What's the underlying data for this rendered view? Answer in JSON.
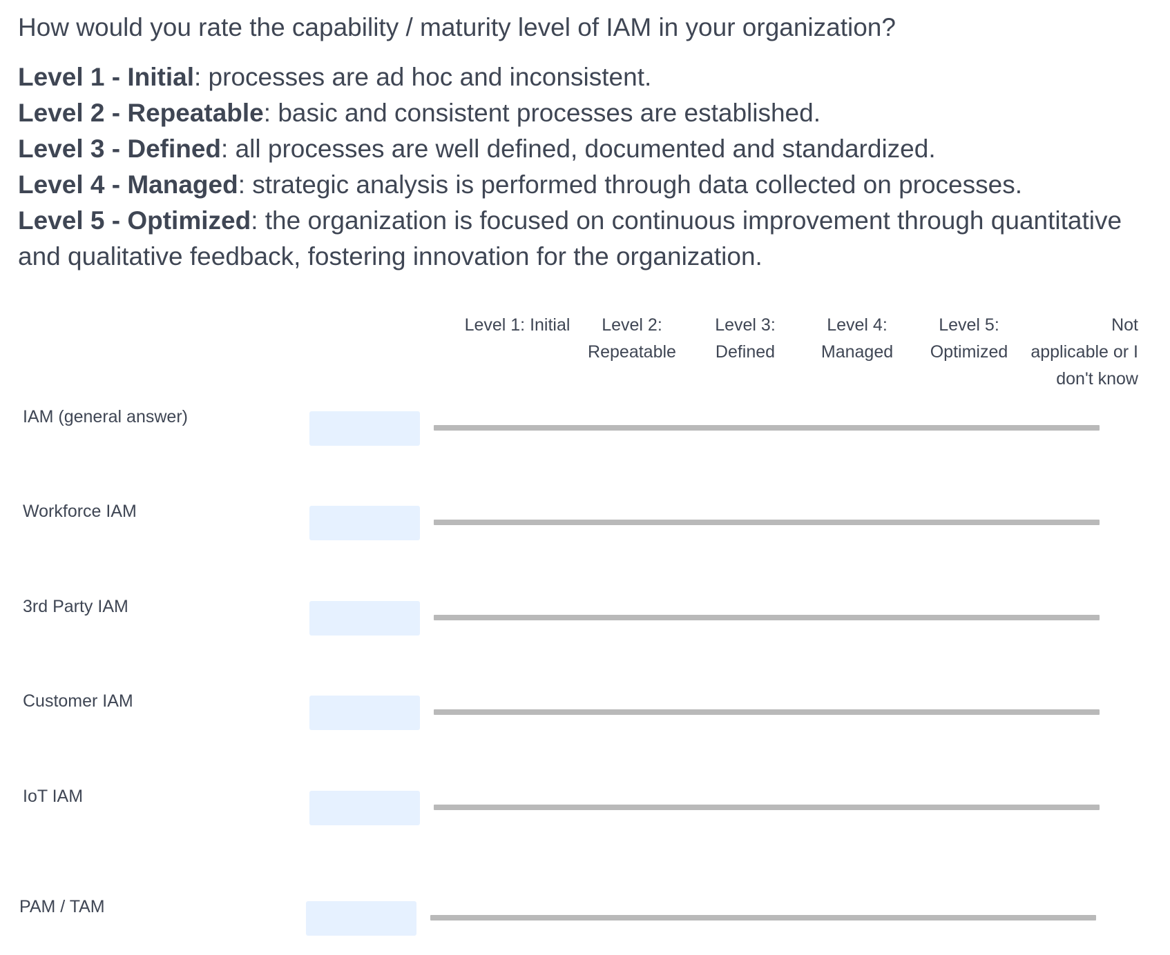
{
  "question": {
    "title": "How would you rate the capability / maturity level of IAM in your organization?",
    "levels": [
      {
        "name": "Level 1 - Initial",
        "desc": ": processes are ad hoc and inconsistent."
      },
      {
        "name": "Level 2 - Repeatable",
        "desc": ": basic and consistent processes are established."
      },
      {
        "name": "Level 3 - Defined",
        "desc": ": all processes are well defined, documented and standardized."
      },
      {
        "name": "Level 4 - Managed",
        "desc": ": strategic analysis is performed through data collected on processes."
      },
      {
        "name": "Level 5 - Optimized",
        "desc": ": the organization is focused on continuous improvement through quantitative and qualitative feedback, fostering innovation for the organization."
      }
    ]
  },
  "columns": [
    "Level 1: Initial",
    "Level 2:\nRepeatable",
    "Level 3:\nDefined",
    "Level 4:\nManaged",
    "Level 5:\nOptimized",
    "Not\napplicable or I\ndon't know"
  ],
  "rows": [
    {
      "label": "IAM (general answer)"
    },
    {
      "label": "Workforce IAM"
    },
    {
      "label": "3rd Party IAM"
    },
    {
      "label": "Customer IAM"
    },
    {
      "label": "IoT IAM"
    },
    {
      "label": "PAM / TAM"
    }
  ],
  "colors": {
    "text": "#3f4654",
    "value_box": "#e6f1ff",
    "slider_track": "#b9b9b9"
  }
}
